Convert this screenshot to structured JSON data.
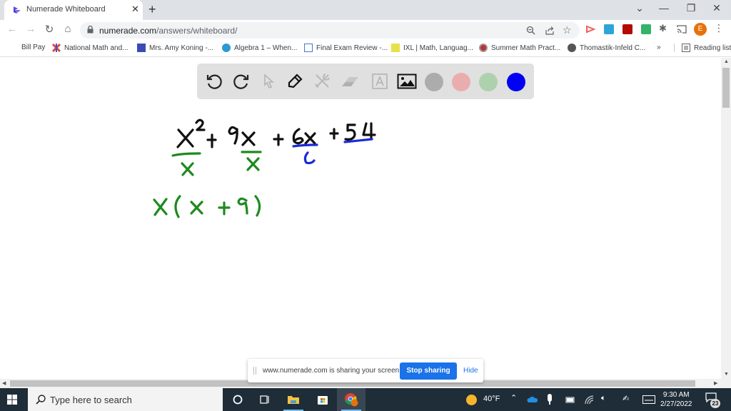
{
  "browser": {
    "tab": {
      "title": "Numerade Whiteboard",
      "close_glyph": "✕",
      "favicon": "numerade-logo-icon"
    },
    "new_tab_glyph": "+",
    "window_controls": {
      "tab_search": "⌄",
      "minimize": "—",
      "restore": "❐",
      "close": "✕"
    },
    "nav": {
      "back": "←",
      "forward": "→",
      "reload": "↻",
      "home": "⌂"
    },
    "address": {
      "domain": "numerade.com",
      "path": "/answers/whiteboard/"
    },
    "omnibox_icons": [
      "zoom-out-icon",
      "share-icon",
      "bookmark-star-icon"
    ],
    "extensions": [
      "numerade-extension-icon",
      "screencastify-icon",
      "adobe-acrobat-icon",
      "green-extension-icon",
      "extensions-puzzle-icon",
      "cast-icon"
    ],
    "profile_initial": "E",
    "menu_glyph": "⋮",
    "bookmarks": [
      {
        "label": "Bill Pay",
        "icon": "none"
      },
      {
        "label": "National Math and...",
        "icon": "nmsi-icon"
      },
      {
        "label": "Mrs. Amy Koning -...",
        "icon": "classroom-icon"
      },
      {
        "label": "Algebra 1 – When...",
        "icon": "wordpress-icon"
      },
      {
        "label": "Final Exam Review -...",
        "icon": "doc-icon"
      },
      {
        "label": "IXL | Math, Languag...",
        "icon": "ixl-icon"
      },
      {
        "label": "Summer Math Pract...",
        "icon": "summer-math-icon"
      },
      {
        "label": "Thomastik-Infeld C...",
        "icon": "globe-icon"
      }
    ],
    "bookmarks_overflow": "»",
    "reading_list": "Reading list"
  },
  "whiteboard": {
    "tools": [
      {
        "name": "undo",
        "enabled": true
      },
      {
        "name": "redo",
        "enabled": true
      },
      {
        "name": "select",
        "enabled": false
      },
      {
        "name": "pen",
        "enabled": true
      },
      {
        "name": "tools",
        "enabled": false
      },
      {
        "name": "eraser",
        "enabled": false
      },
      {
        "name": "text",
        "enabled": false
      },
      {
        "name": "image",
        "enabled": true
      }
    ],
    "colors": [
      {
        "name": "gray",
        "hex": "#acacac",
        "selected": false
      },
      {
        "name": "pink",
        "hex": "#eaadad",
        "selected": false
      },
      {
        "name": "green",
        "hex": "#add1ad",
        "selected": false
      },
      {
        "name": "blue",
        "hex": "#0000f5",
        "selected": true
      }
    ],
    "ink_colors": {
      "black": "#111111",
      "green": "#1e8a1e",
      "blue": "#1a2ad8"
    },
    "handwriting": {
      "line1": "x² + 9x + 6x + 54",
      "under_x2": "x",
      "under_9x": "x",
      "under_6x": "6",
      "line2": "x(x + 9)"
    }
  },
  "share_banner": {
    "message": "www.numerade.com is sharing your screen.",
    "stop_label": "Stop sharing",
    "hide_label": "Hide"
  },
  "taskbar": {
    "search_placeholder": "Type here to search",
    "apps": [
      "cortana-icon",
      "task-view-icon",
      "file-explorer-icon",
      "microsoft-store-icon",
      "chrome-icon"
    ],
    "weather": "40°F",
    "time": "9:30 AM",
    "date": "2/27/2022",
    "notifications": "23"
  }
}
